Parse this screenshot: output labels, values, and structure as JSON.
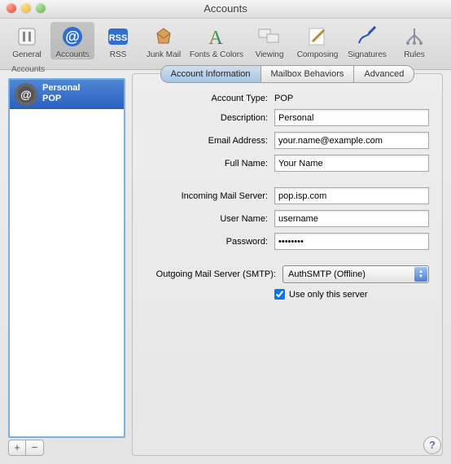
{
  "window": {
    "title": "Accounts"
  },
  "toolbar": {
    "items": [
      {
        "label": "General"
      },
      {
        "label": "Accounts"
      },
      {
        "label": "RSS"
      },
      {
        "label": "Junk Mail"
      },
      {
        "label": "Fonts & Colors"
      },
      {
        "label": "Viewing"
      },
      {
        "label": "Composing"
      },
      {
        "label": "Signatures"
      },
      {
        "label": "Rules"
      }
    ],
    "selected_index": 1
  },
  "sidebar": {
    "heading": "Accounts",
    "items": [
      {
        "name": "Personal",
        "subtype": "POP"
      }
    ],
    "add_label": "+",
    "remove_label": "−"
  },
  "tabs": {
    "items": [
      "Account Information",
      "Mailbox Behaviors",
      "Advanced"
    ],
    "active_index": 0
  },
  "form": {
    "account_type_label": "Account Type:",
    "account_type_value": "POP",
    "description_label": "Description:",
    "description_value": "Personal",
    "email_label": "Email Address:",
    "email_value": "your.name@example.com",
    "fullname_label": "Full Name:",
    "fullname_value": "Your Name",
    "incoming_label": "Incoming Mail Server:",
    "incoming_value": "pop.isp.com",
    "username_label": "User Name:",
    "username_value": "username",
    "password_label": "Password:",
    "password_value": "••••••••",
    "outgoing_label": "Outgoing Mail Server (SMTP):",
    "outgoing_value": "AuthSMTP (Offline)",
    "useonly_label": "Use only this server",
    "useonly_checked": true
  },
  "help_glyph": "?"
}
